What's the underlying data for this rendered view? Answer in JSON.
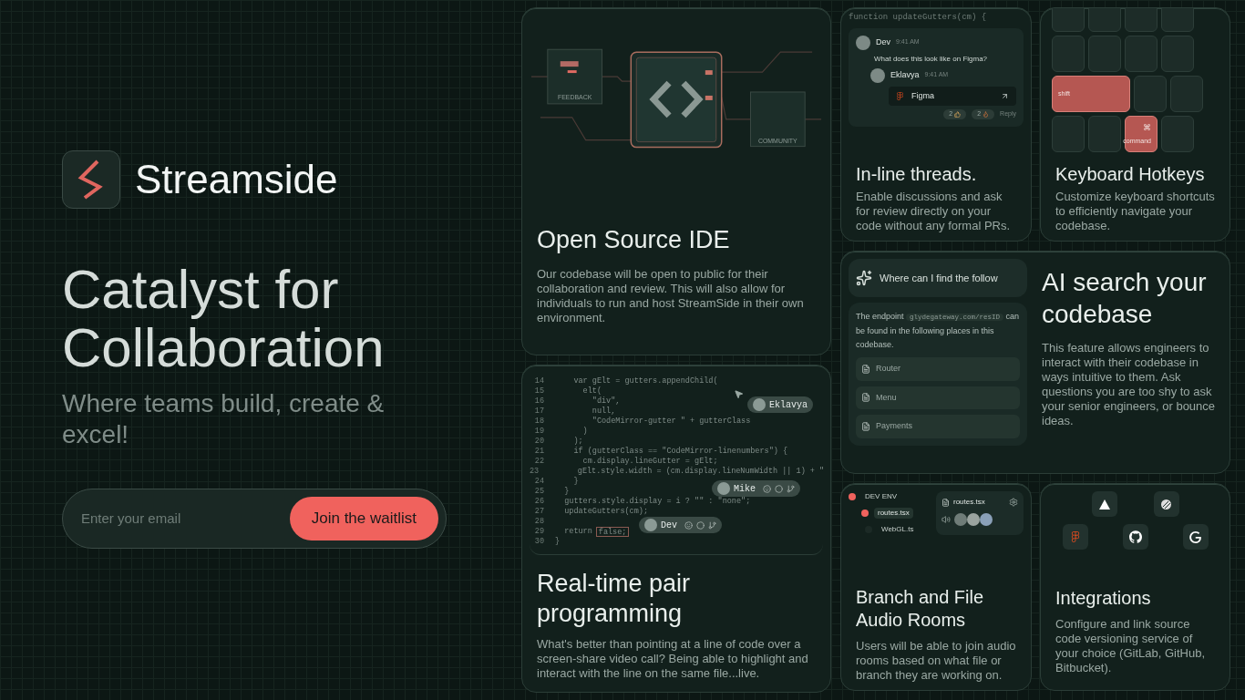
{
  "hero": {
    "brand": "Streamside",
    "headline": "Catalyst for Collaboration",
    "tagline": "Where teams build, create & excel!",
    "email": {
      "placeholder": "Enter your email"
    },
    "cta": "Join the waitlist"
  },
  "open_source": {
    "labels": [
      "FEEDBACK",
      "COMMUNITY"
    ],
    "title": "Open Source IDE",
    "description": "Our codebase will be open to public for their collaboration and review. This will also allow for individuals to run and host StreamSide in their own environment."
  },
  "pair": {
    "code": [
      {
        "num": "14",
        "text": "    var gElt = gutters.appendChild("
      },
      {
        "num": "15",
        "text": "      elt("
      },
      {
        "num": "16",
        "text": "        \"div\","
      },
      {
        "num": "17",
        "text": "        null,"
      },
      {
        "num": "18",
        "text": "        \"CodeMirror-gutter \" + gutterClass"
      },
      {
        "num": "19",
        "text": "      )"
      },
      {
        "num": "20",
        "text": "    );"
      },
      {
        "num": "21",
        "text": "    if (gutterClass == \"CodeMirror-linenumbers\") {"
      },
      {
        "num": "22",
        "text": "      cm.display.lineGutter = gElt;"
      },
      {
        "num": "23",
        "text": "      gElt.style.width = (cm.display.lineNumWidth || 1) + \""
      },
      {
        "num": "24",
        "text": "    }"
      },
      {
        "num": "25",
        "text": "  }"
      },
      {
        "num": "26",
        "text": "  gutters.style.display = i ? \"\" : \"none\";"
      },
      {
        "num": "27",
        "text": "  updateGutters(cm);"
      },
      {
        "num": "28"
      },
      {
        "num": "29",
        "text": "  return",
        "boxed": "false;"
      },
      {
        "num": "30",
        "text": "}"
      }
    ],
    "cursors": [
      {
        "name": "Eklavya",
        "kind": "pointer"
      },
      {
        "name": "Mike",
        "kind": "toolbar"
      },
      {
        "name": "Dev",
        "kind": "toolbar"
      }
    ],
    "title": "Real-time pair programming",
    "description": "What's better than pointing at a line of code over a screen-share video call? Being able to highlight and interact with the line on the same file...live."
  },
  "threads": {
    "code": "function updateGutters(cm) {",
    "messages": [
      {
        "author": "Dev",
        "time": "9:41 AM",
        "text": "What does this look like on Figma?"
      },
      {
        "author": "Eklavya",
        "time": "9:41 AM",
        "link": "Figma"
      }
    ],
    "reactions": [
      {
        "count": "2",
        "kind": "thumbs"
      },
      {
        "count": "2",
        "kind": "fire"
      }
    ],
    "reply": "Reply",
    "title": "In-line threads.",
    "description": "Enable discussions and ask for review directly on your code without any formal PRs."
  },
  "hotkeys": {
    "rows": [
      [
        {
          "pressed": false
        },
        {
          "pressed": false
        },
        {
          "pressed": false
        },
        {
          "pressed": false
        }
      ],
      [
        {
          "pressed": false
        },
        {
          "pressed": false
        },
        {
          "pressed": false
        },
        {
          "pressed": false
        }
      ],
      [
        {
          "label": "shift",
          "pressed": true,
          "kind": "wide"
        },
        {
          "pressed": false
        },
        {
          "pressed": false
        }
      ],
      [
        {
          "pressed": false
        },
        {
          "pressed": false
        },
        {
          "symbol": "⌘",
          "label": "command",
          "pressed": true
        },
        {
          "pressed": false
        }
      ]
    ],
    "title": "Keyboard Hotkeys",
    "description": "Customize keyboard shortcuts to efficiently navigate your codebase."
  },
  "ai": {
    "query": "Where can I find the follow",
    "answer_before": "The endpoint",
    "endpoint": "glydegateway.com/resID",
    "answer_after": "can be found in the following places in this codebase.",
    "files": [
      "Router",
      "Menu",
      "Payments"
    ],
    "title": "AI search your codebase",
    "description": "This feature allows engineers to interact with their codebase in ways intuitive to them. Ask questions you are too shy to ask your senior engineers, or bounce ideas."
  },
  "rooms": {
    "branches": [
      {
        "name": "DEV ENV",
        "color": "#f0625d",
        "selected": false
      },
      {
        "name": "routes.tsx",
        "color": "#f0625d",
        "selected": true
      },
      {
        "name": "WebGL.ts",
        "color": "#1c2a26",
        "selected": false
      }
    ],
    "room_file": "routes.tsx",
    "title": "Branch and File Audio Rooms",
    "description": "Users will be able to join audio rooms based on what file or branch they are working on."
  },
  "integrations": {
    "title": "Integrations",
    "description": "Configure and link source code versioning service of your choice (GitLab, GitHub, Bitbucket)."
  }
}
